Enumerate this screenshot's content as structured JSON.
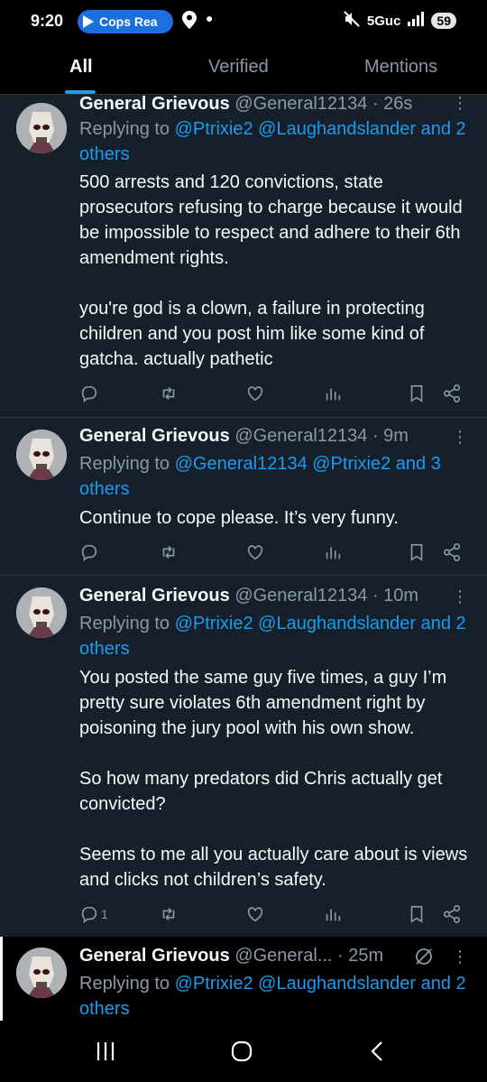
{
  "status_bar": {
    "time": "9:20",
    "media_pill": "Cops Rea",
    "network": "5Guc",
    "battery": "59"
  },
  "tabs": [
    {
      "label": "All",
      "active": true
    },
    {
      "label": "Verified",
      "active": false
    },
    {
      "label": "Mentions",
      "active": false
    }
  ],
  "tweets": [
    {
      "name": "General Grievous",
      "handle": "@General12134 · 26s",
      "replying_prefix": "Replying to ",
      "replying_mentions": "@Ptrixie2 @Laughandslander and 2 others",
      "body": [
        "500 arrests and 120 convictions, state prosecutors refusing to charge because it would be impossible to respect and adhere to their 6th amendment rights.",
        "you're god is a clown, a failure in protecting children and you post him like some kind of gatcha. actually pathetic"
      ],
      "reply_count": ""
    },
    {
      "name": "General Grievous",
      "handle": "@General12134 · 9m",
      "replying_prefix": "Replying to ",
      "replying_mentions": "@General12134 @Ptrixie2 and 3 others",
      "body": [
        "Continue to cope please. It’s very funny."
      ],
      "reply_count": ""
    },
    {
      "name": "General Grievous",
      "handle": "@General12134 · 10m",
      "replying_prefix": "Replying to ",
      "replying_mentions": "@Ptrixie2 @Laughandslander and 2 others",
      "body": [
        "You posted the same guy five times, a guy I’m pretty sure violates 6th amendment right by poisoning the jury pool with his own show.",
        "So how many predators did Chris actually get convicted?",
        "Seems to me all you actually care about is views and clicks not children’s safety."
      ],
      "reply_count": "1"
    },
    {
      "name": "General Grievous",
      "handle": "@General... · 25m",
      "replying_prefix": "Replying to ",
      "replying_mentions": "@Ptrixie2 @Laughandslander and 2 others",
      "body": [],
      "reply_count": ""
    }
  ],
  "icons": {
    "reply": "reply-icon",
    "retweet": "retweet-icon",
    "like": "heart-icon",
    "views": "views-icon",
    "bookmark": "bookmark-icon",
    "share": "share-icon",
    "more": "more-icon",
    "muted": "mute-slash-icon"
  },
  "colors": {
    "background": "#15202b",
    "accent": "#1d9bf0",
    "secondary_text": "#8b98a5",
    "divider": "#2f3336"
  }
}
